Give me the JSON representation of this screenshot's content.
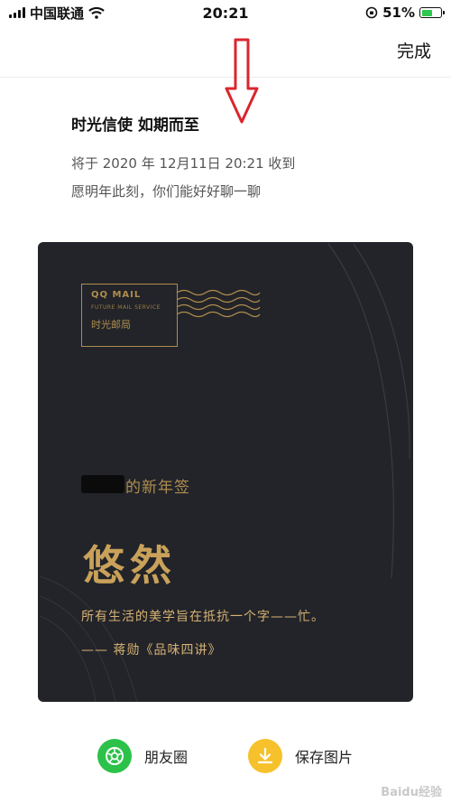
{
  "status_bar": {
    "carrier": "中国联通",
    "time": "20:21",
    "battery": "51%"
  },
  "nav": {
    "done_label": "完成"
  },
  "header": {
    "title": "时光信使 如期而至",
    "delivery_line": "将于 2020 年 12月11日 20:21 收到",
    "message_line": "愿明年此刻，你们能好好聊一聊"
  },
  "card": {
    "stamp_title": "QQ MAIL",
    "stamp_subtitle": "FUTURE MAIL SERVICE",
    "stamp_cn": "时光邮局",
    "greeting": "的新年签",
    "headline": "悠然",
    "quote": "所有生活的美学旨在抵抗一个字——忙。",
    "author": "—— 蒋勋《品味四讲》"
  },
  "actions": {
    "moments_label": "朋友圈",
    "save_label": "保存图片"
  },
  "watermark": "Baidu经验",
  "colors": {
    "accent_gold": "#b08d4e",
    "card_bg": "#222429",
    "moments_green": "#2cc24a",
    "save_yellow": "#f6c12b",
    "arrow_red": "#d9262c"
  },
  "icons": [
    "wifi-icon",
    "lock-rotation-icon",
    "red-down-arrow",
    "camera-shutter-icon",
    "download-icon"
  ]
}
